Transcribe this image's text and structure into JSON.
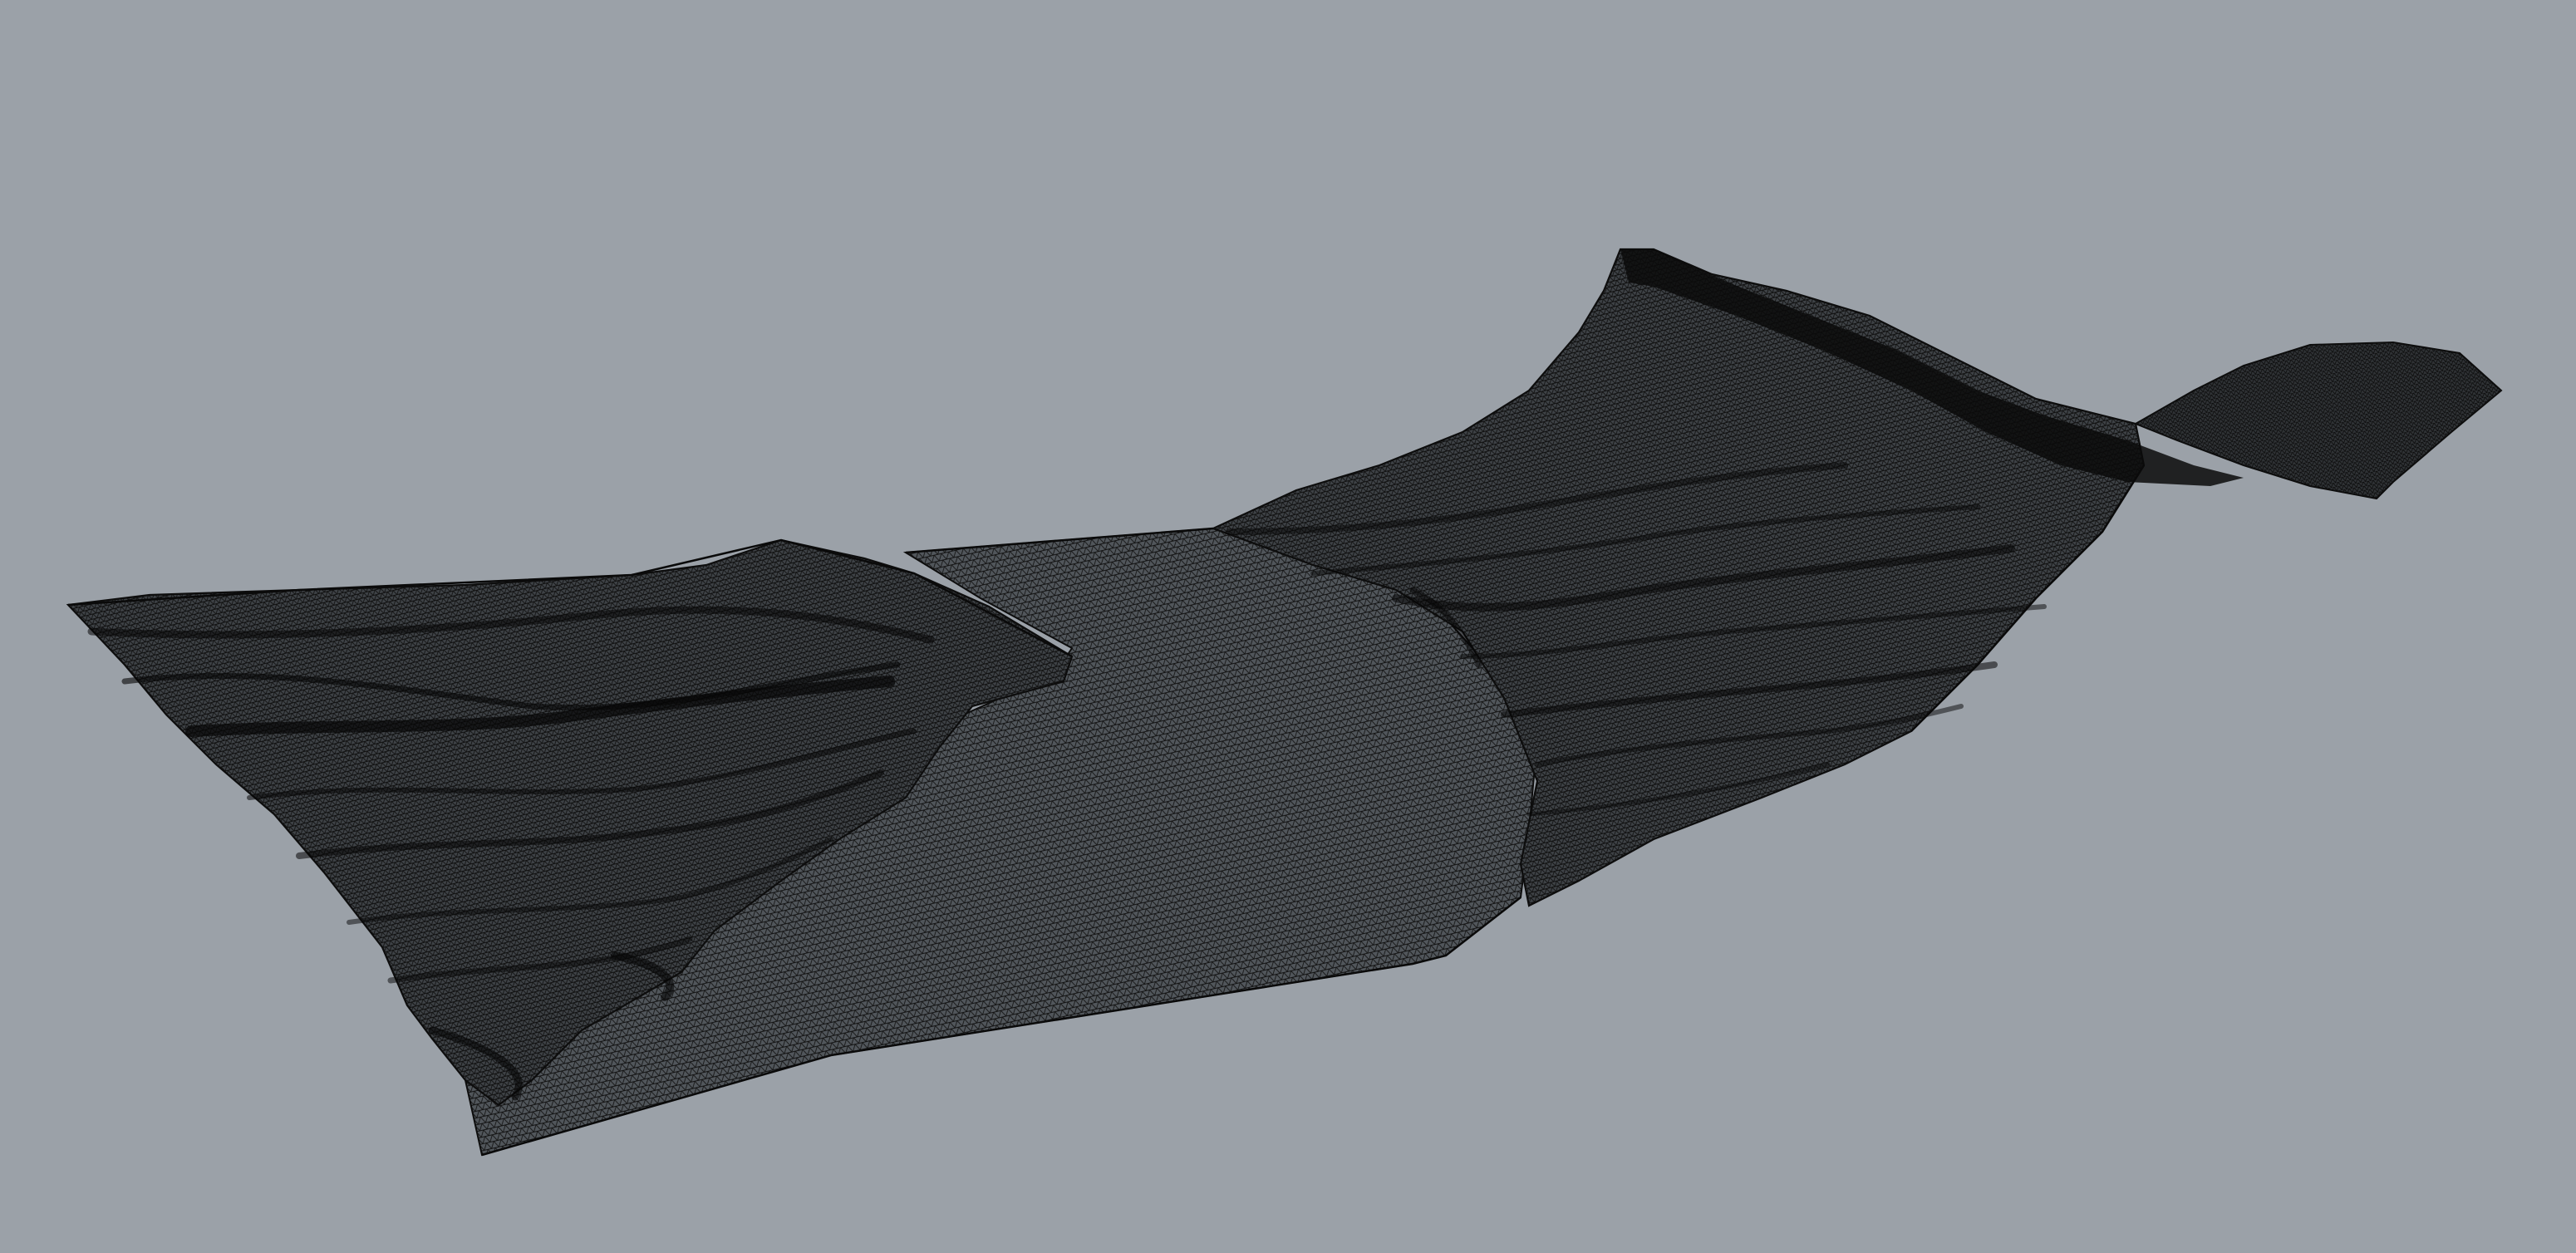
{
  "viewport": {
    "background_color": "#9ba1a8",
    "wire_color": "#0d0d0d",
    "display_mode": "wireframe",
    "object": "terrain-mesh"
  }
}
